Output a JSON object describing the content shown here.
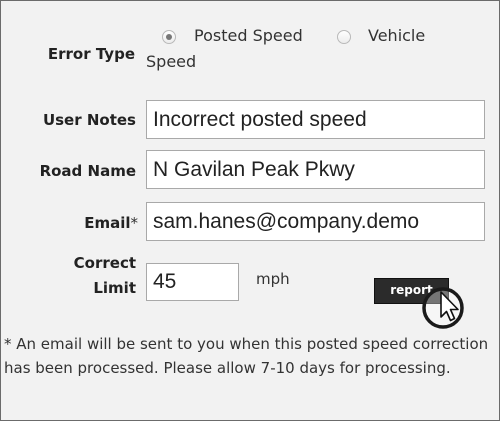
{
  "form": {
    "error_type": {
      "label": "Error Type",
      "options": [
        {
          "label": "Posted Speed",
          "selected": true
        },
        {
          "label": "Vehicle",
          "selected": false
        }
      ],
      "wrap_text": "Speed"
    },
    "user_notes": {
      "label": "User Notes",
      "value": "Incorrect posted speed"
    },
    "road_name": {
      "label": "Road Name",
      "value": "N Gavilan Peak Pkwy"
    },
    "email": {
      "label": "Email",
      "required_marker": "*",
      "value": "sam.hanes@company.demo"
    },
    "correct_limit": {
      "label_line1": "Correct",
      "label_line2": "Limit",
      "value": "45",
      "unit": "mph"
    },
    "report_button": {
      "label": "report"
    },
    "note": "* An email will be sent to you when this posted speed correction has been processed. Please allow 7-10 days for processing."
  },
  "cursor": {
    "icon": "pointer-arrow-cursor-icon"
  }
}
